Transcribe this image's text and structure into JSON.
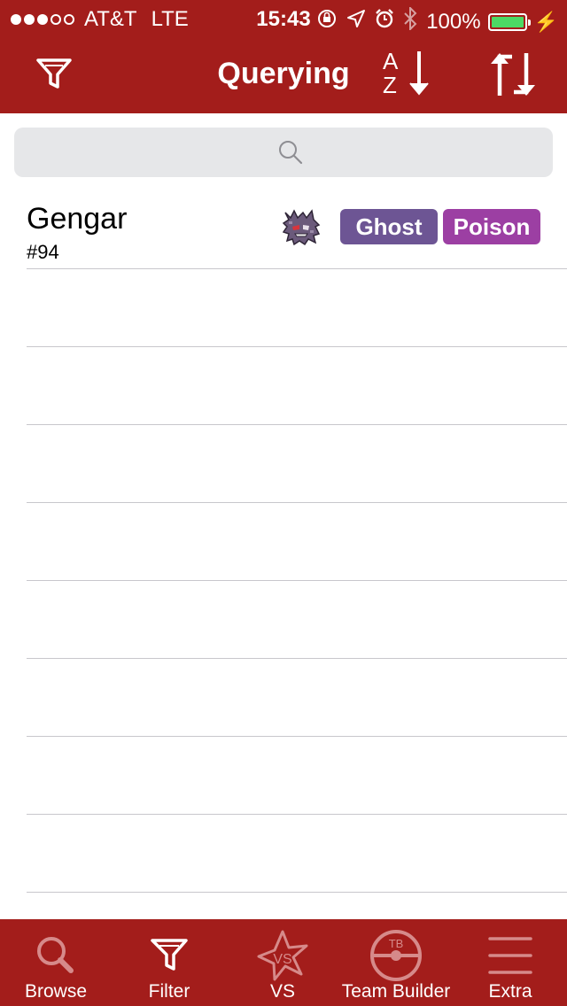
{
  "status_bar": {
    "carrier": "AT&T",
    "network": "LTE",
    "time": "15:43",
    "battery": "100%",
    "signal_bars_filled": 3,
    "signal_bars_total": 5
  },
  "nav": {
    "title": "Querying",
    "sort_az": "A\nZ",
    "colors": {
      "bar": "#a31d1b"
    }
  },
  "search": {
    "placeholder": ""
  },
  "results": [
    {
      "name": "Gengar",
      "number": "#94",
      "sprite": "gengar-sprite",
      "types": [
        {
          "label": "Ghost",
          "color": "#6d5594"
        },
        {
          "label": "Poison",
          "color": "#9c3fa3"
        }
      ]
    }
  ],
  "tabbar": {
    "tabs": [
      {
        "label": "Browse",
        "icon": "search-icon"
      },
      {
        "label": "Filter",
        "icon": "filter-icon"
      },
      {
        "label": "VS",
        "icon": "vs-star-icon",
        "icon_text": "VS"
      },
      {
        "label": "Team Builder",
        "icon": "pokeball-icon",
        "icon_text": "TB"
      },
      {
        "label": "Extra",
        "icon": "menu-icon"
      }
    ]
  }
}
